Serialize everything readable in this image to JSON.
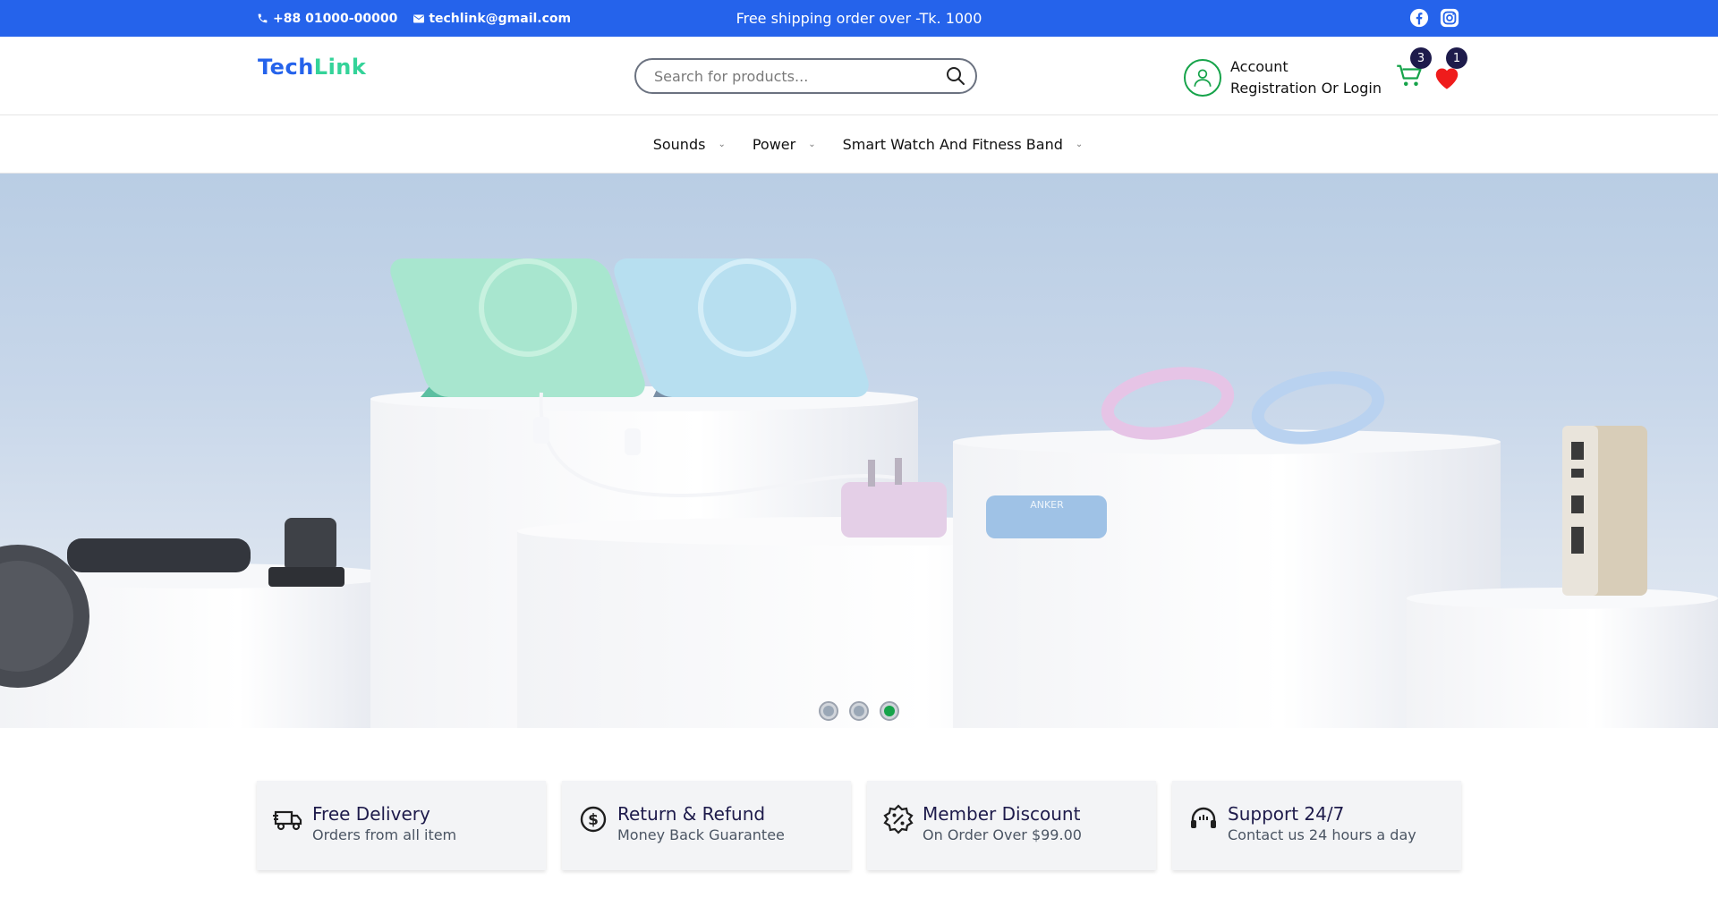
{
  "topbar": {
    "phone": "+88 01000-00000",
    "email": "techlink@gmail.com",
    "promo": "Free shipping order over -Tk. 1000",
    "social": [
      "facebook-icon",
      "instagram-icon"
    ]
  },
  "header": {
    "logo_part1": "Tech",
    "logo_part2": "Link",
    "search_placeholder": "Search for products...",
    "account_title": "Account",
    "account_subtitle": "Registration Or Login",
    "cart_count": "3",
    "wishlist_count": "1"
  },
  "nav": {
    "items": [
      {
        "label": "Sounds"
      },
      {
        "label": "Power"
      },
      {
        "label": "Smart Watch And Fitness Band"
      }
    ]
  },
  "hero": {
    "slide_count": 3,
    "active_slide": 3,
    "product_brand": "ANKER"
  },
  "features": [
    {
      "icon": "truck-icon",
      "title": "Free Delivery",
      "subtitle": "Orders from all item"
    },
    {
      "icon": "dollar-refund-icon",
      "title": "Return & Refund",
      "subtitle": "Money Back Guarantee"
    },
    {
      "icon": "percent-badge-icon",
      "title": "Member Discount",
      "subtitle": "On Order Over $99.00"
    },
    {
      "icon": "headset-icon",
      "title": "Support 24/7",
      "subtitle": "Contact us 24 hours a day"
    }
  ],
  "colors": {
    "topbar": "#2563eb",
    "accent_green": "#16a34a",
    "badge": "#1e1b4b",
    "heart": "#ef1c1c"
  }
}
